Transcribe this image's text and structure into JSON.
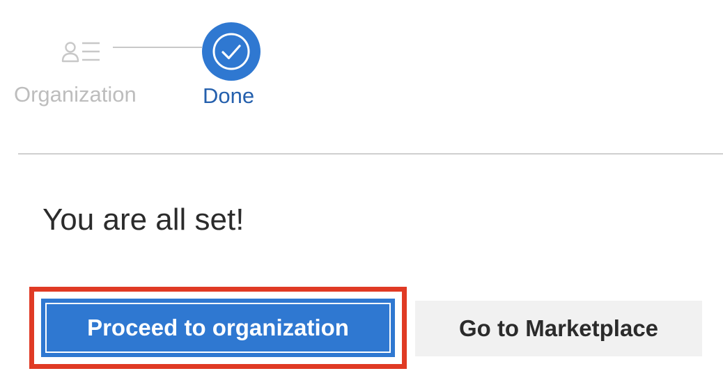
{
  "stepper": {
    "steps": [
      {
        "label": "Organization",
        "state": "completed",
        "icon": "organization-list-icon"
      },
      {
        "label": "Done",
        "state": "current",
        "icon": "checkmark-icon"
      }
    ]
  },
  "main": {
    "heading": "You are all set!"
  },
  "actions": {
    "primary_label": "Proceed to organization",
    "secondary_label": "Go to Marketplace"
  },
  "colors": {
    "accent": "#2f78d1",
    "accent_text": "#2560ad",
    "highlight": "#e03a24",
    "muted": "#bdbdbd",
    "secondary_bg": "#f1f1f1"
  }
}
